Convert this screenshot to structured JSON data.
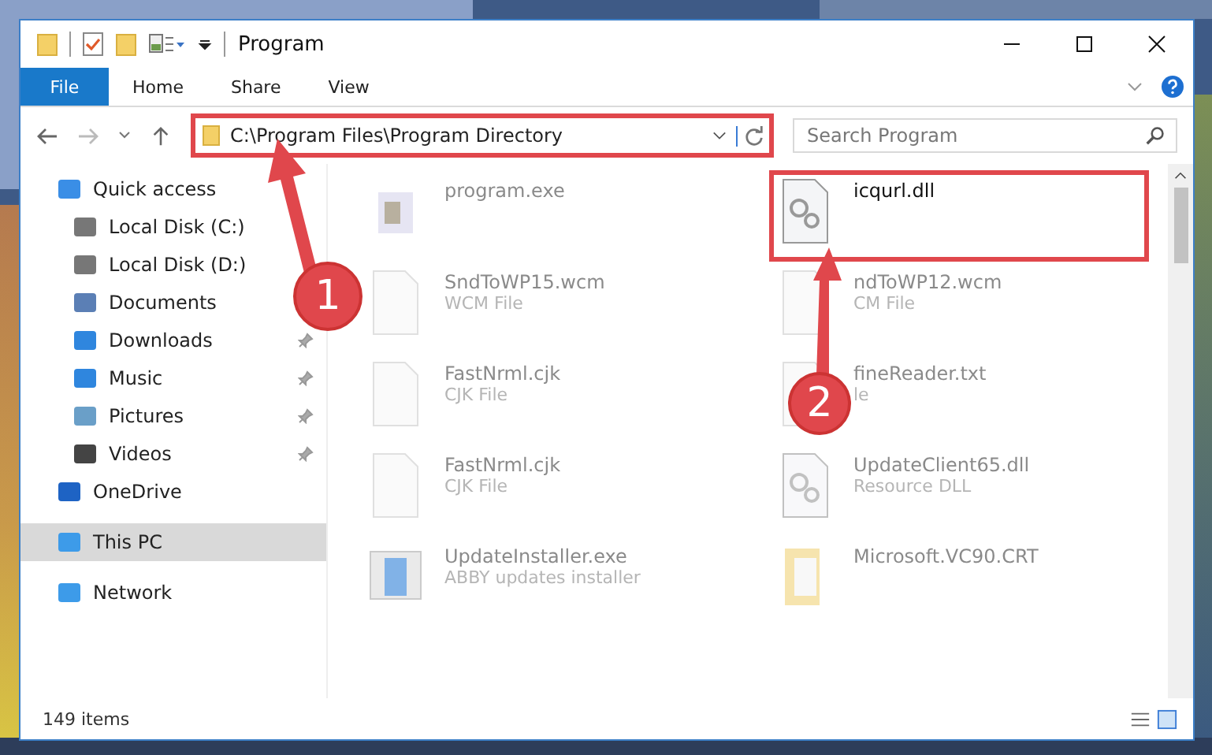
{
  "window": {
    "title": "Program"
  },
  "ribbon": {
    "tabs": [
      {
        "label": "File",
        "selected": true
      },
      {
        "label": "Home",
        "selected": false
      },
      {
        "label": "Share",
        "selected": false
      },
      {
        "label": "View",
        "selected": false
      }
    ]
  },
  "address": {
    "path": "C:\\Program Files\\Program Directory",
    "highlighted": true
  },
  "search": {
    "placeholder": "Search Program"
  },
  "sidebar": {
    "items": [
      {
        "label": "Quick access",
        "kind": "quick",
        "selected": false,
        "children": [
          {
            "label": "Local Disk (C:)",
            "kind": "diskc",
            "pinned": false,
            "selected": false
          },
          {
            "label": "Local Disk (D:)",
            "kind": "disk",
            "pinned": false,
            "selected": false
          },
          {
            "label": "Documents",
            "kind": "docs",
            "pinned": false,
            "selected": false
          },
          {
            "label": "Downloads",
            "kind": "down",
            "pinned": true,
            "selected": false
          },
          {
            "label": "Music",
            "kind": "music",
            "pinned": true,
            "selected": false
          },
          {
            "label": "Pictures",
            "kind": "pics",
            "pinned": true,
            "selected": false
          },
          {
            "label": "Videos",
            "kind": "video",
            "pinned": true,
            "selected": false
          }
        ]
      },
      {
        "label": "OneDrive",
        "kind": "cloud",
        "selected": false
      },
      {
        "label": "This PC",
        "kind": "pc",
        "selected": true
      },
      {
        "label": "Network",
        "kind": "net",
        "selected": false
      }
    ]
  },
  "files": [
    {
      "name": "program.exe",
      "kind": "exe",
      "blurred": true,
      "highlighted": false
    },
    {
      "name": "icqurl.dll",
      "kind": "dll",
      "blurred": false,
      "highlighted": true
    },
    {
      "name": "SndToWP15.wcm",
      "type": "WCM File",
      "kind": "doc",
      "blurred": true,
      "highlighted": false
    },
    {
      "name": "ndToWP12.wcm",
      "type": "CM File",
      "kind": "doc",
      "blurred": true,
      "highlighted": false
    },
    {
      "name": "FastNrml.cjk",
      "type": "CJK File",
      "kind": "doc",
      "blurred": true,
      "highlighted": false
    },
    {
      "name": "fineReader.txt",
      "type": "le",
      "kind": "txt",
      "blurred": true,
      "highlighted": false
    },
    {
      "name": "FastNrml.cjk",
      "type": "CJK File",
      "kind": "doc",
      "blurred": true,
      "highlighted": false
    },
    {
      "name": "UpdateClient65.dll",
      "type": "Resource DLL",
      "kind": "dll",
      "blurred": true,
      "highlighted": false
    },
    {
      "name": "UpdateInstaller.exe",
      "type": "ABBY updates installer",
      "kind": "installer",
      "blurred": true,
      "highlighted": false
    },
    {
      "name": "Microsoft.VC90.CRT",
      "kind": "folder",
      "blurred": true,
      "highlighted": false
    }
  ],
  "status_bar": {
    "count": "149 items"
  },
  "annotations": [
    {
      "label": "1"
    },
    {
      "label": "2"
    }
  ]
}
